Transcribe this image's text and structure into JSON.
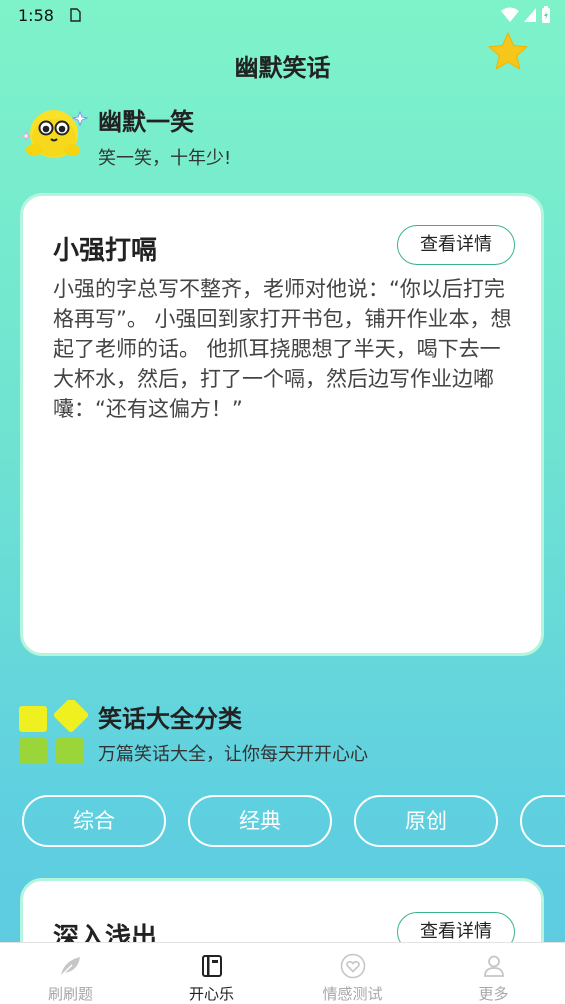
{
  "status_bar": {
    "time": "1:58"
  },
  "header": {
    "title": "幽默笑话"
  },
  "section_humor": {
    "title": "幽默一笑",
    "subtitle": "笑一笑，十年少!"
  },
  "joke_card": {
    "title": "小强打嗝",
    "detail_label": "查看详情",
    "body": "小强的字总写不整齐，老师对他说：“你以后打完格再写”。 小强回到家打开书包，铺开作业本，想起了老师的话。 他抓耳挠腮想了半天，喝下去一大杯水，然后，打了一个嗝，然后边写作业边嘟囔：“还有这偏方！”"
  },
  "section_categories": {
    "title": "笑话大全分类",
    "subtitle": "万篇笑话大全，让你每天开开心心",
    "chips": [
      "综合",
      "经典",
      "原创",
      ""
    ]
  },
  "second_card": {
    "title": "深入浅出",
    "detail_label": "查看详情"
  },
  "tab_bar": {
    "tabs": [
      {
        "label": "刷刷题",
        "icon": "feather-icon"
      },
      {
        "label": "开心乐",
        "icon": "notebook-icon"
      },
      {
        "label": "情感测试",
        "icon": "heart-icon"
      },
      {
        "label": "更多",
        "icon": "user-icon"
      }
    ],
    "active_index": 1
  },
  "colors": {
    "accent_border": "#3bb38a",
    "star": "#f7c61b",
    "category_yellow": "#f0f020",
    "category_green": "#9ad63a"
  }
}
